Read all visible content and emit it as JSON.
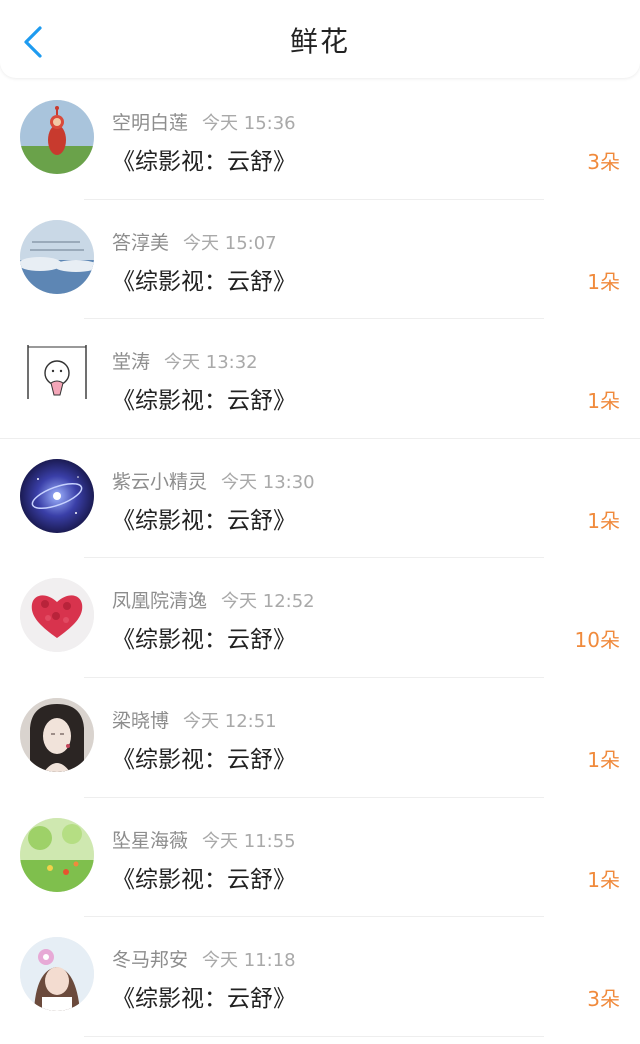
{
  "header": {
    "title": "鲜花"
  },
  "items": [
    {
      "name": "空明白莲",
      "time": "今天 15:36",
      "book": "《综影视：云舒》",
      "count": "3朵"
    },
    {
      "name": "答淳美",
      "time": "今天 15:07",
      "book": "《综影视：云舒》",
      "count": "1朵"
    },
    {
      "name": "堂涛",
      "time": "今天 13:32",
      "book": "《综影视：云舒》",
      "count": "1朵"
    },
    {
      "name": "紫云小精灵",
      "time": "今天 13:30",
      "book": "《综影视：云舒》",
      "count": "1朵"
    },
    {
      "name": "凤凰院清逸",
      "time": "今天 12:52",
      "book": "《综影视：云舒》",
      "count": "10朵"
    },
    {
      "name": "梁晓博",
      "time": "今天 12:51",
      "book": "《综影视：云舒》",
      "count": "1朵"
    },
    {
      "name": "坠星海薇",
      "time": "今天 11:55",
      "book": "《综影视：云舒》",
      "count": "1朵"
    },
    {
      "name": "冬马邦安",
      "time": "今天 11:18",
      "book": "《综影视：云舒》",
      "count": "3朵"
    }
  ],
  "colors": {
    "accent": "#f08a3c",
    "back": "#1e9bf0"
  },
  "icons": {
    "back": "chevron-left-icon"
  }
}
